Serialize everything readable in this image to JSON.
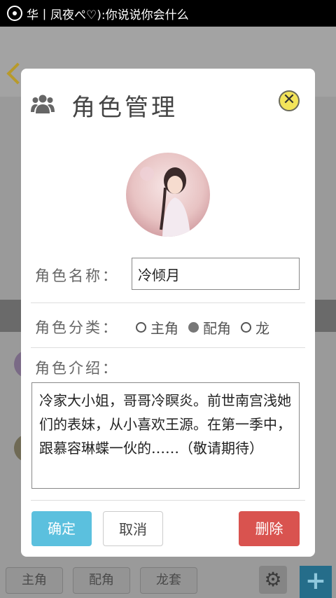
{
  "status_bar": {
    "text": "华丨凤夜ぺ♡):你说说你会什么"
  },
  "background": {
    "tabs": [
      "主角",
      "配角",
      "龙套"
    ],
    "colors": {
      "plus": "#256d8a"
    }
  },
  "dialog": {
    "title": "角色管理",
    "icons": {
      "header": "group-icon",
      "close": "close-icon"
    },
    "name_label": "角色名称：",
    "name_value": "冷倾月",
    "category_label": "角色分类：",
    "category_options": [
      {
        "label": "主角",
        "selected": false
      },
      {
        "label": "配角",
        "selected": true
      },
      {
        "label": "龙",
        "selected": false
      }
    ],
    "intro_label": "角色介绍：",
    "intro_text": "冷家大小姐，哥哥冷瞑炎。前世南宫浅她们的表妹，从小喜欢王源。在第一季中，跟慕容琳蝶一伙的……（敬请期待）",
    "buttons": {
      "confirm": "确定",
      "cancel": "取消",
      "delete": "删除"
    },
    "colors": {
      "confirm": "#5bc0de",
      "delete": "#d9534f",
      "close": "#f3e45a"
    }
  }
}
